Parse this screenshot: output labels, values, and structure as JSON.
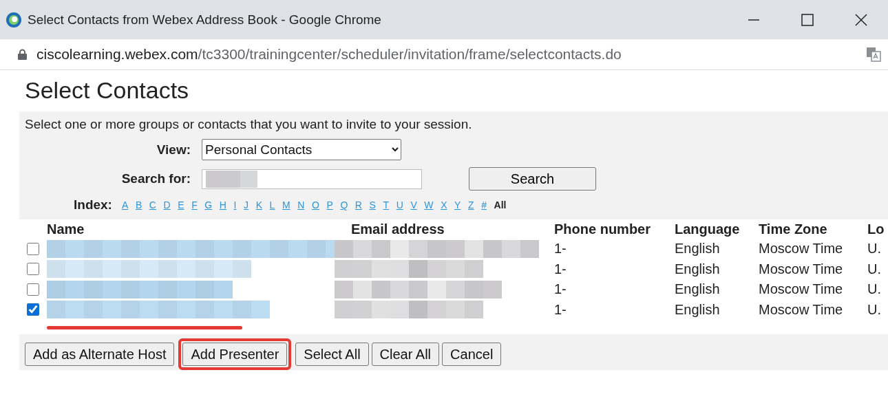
{
  "window": {
    "title": "Select Contacts from Webex Address Book - Google Chrome",
    "url_host": "ciscolearning.webex.com",
    "url_path": "/tc3300/trainingcenter/scheduler/invitation/frame/selectcontacts.do"
  },
  "heading": "Select Contacts",
  "instruction": "Select one or more groups or contacts that you want to invite to your session.",
  "view": {
    "label": "View:",
    "value": "Personal Contacts"
  },
  "search": {
    "label": "Search for:",
    "button": "Search"
  },
  "index": {
    "label": "Index:",
    "letters": [
      "A",
      "B",
      "C",
      "D",
      "E",
      "F",
      "G",
      "H",
      "I",
      "J",
      "K",
      "L",
      "M",
      "N",
      "O",
      "P",
      "Q",
      "R",
      "S",
      "T",
      "U",
      "V",
      "W",
      "X",
      "Y",
      "Z",
      "#"
    ],
    "all": "All"
  },
  "table": {
    "columns": [
      "Name",
      "Email address",
      "Phone number",
      "Language",
      "Time Zone",
      "Lo"
    ],
    "rows": [
      {
        "checked": false,
        "underlined": false,
        "phone": "1-",
        "language": "English",
        "time_zone": "Moscow Time",
        "column_6": "U."
      },
      {
        "checked": false,
        "underlined": false,
        "phone": "1-",
        "language": "English",
        "time_zone": "Moscow Time",
        "column_6": "U."
      },
      {
        "checked": false,
        "underlined": false,
        "phone": "1-",
        "language": "English",
        "time_zone": "Moscow Time",
        "column_6": "U."
      },
      {
        "checked": true,
        "underlined": true,
        "phone": "1-",
        "language": "English",
        "time_zone": "Moscow Time",
        "column_6": "U."
      }
    ]
  },
  "buttons": [
    {
      "label": "Add as Alternate Host",
      "highlighted": false
    },
    {
      "label": "Add Presenter",
      "highlighted": true
    },
    {
      "label": "Select All",
      "highlighted": false
    },
    {
      "label": "Clear All",
      "highlighted": false
    },
    {
      "label": "Cancel",
      "highlighted": false
    }
  ]
}
